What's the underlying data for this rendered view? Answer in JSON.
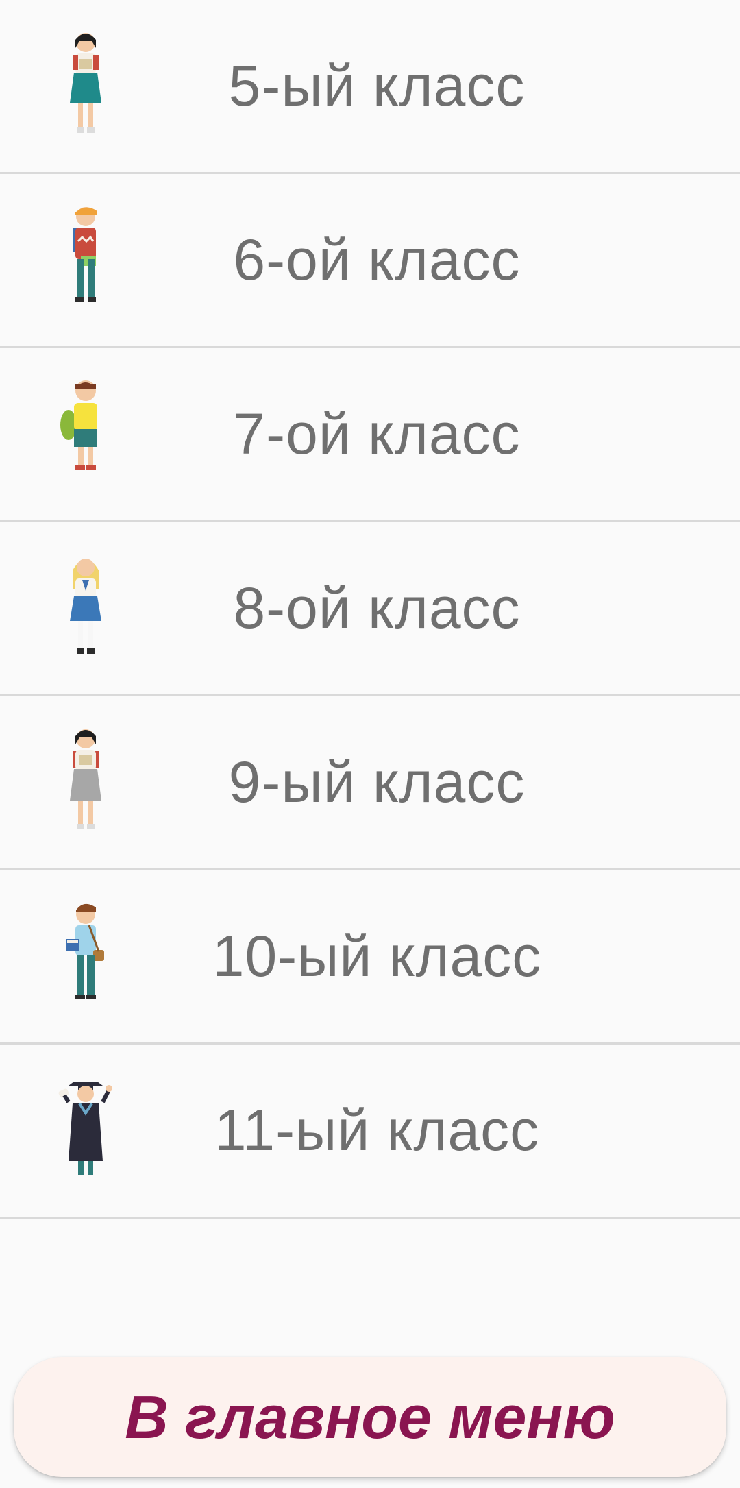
{
  "grades": [
    {
      "label": "5-ый класс",
      "icon": "student-girl-green-skirt-icon"
    },
    {
      "label": "6-ой класс",
      "icon": "student-boy-red-sweater-icon"
    },
    {
      "label": "7-ой класс",
      "icon": "student-boy-yellow-shirt-icon"
    },
    {
      "label": "8-ой класс",
      "icon": "student-girl-blonde-blue-skirt-icon"
    },
    {
      "label": "9-ый класс",
      "icon": "student-girl-grey-skirt-icon"
    },
    {
      "label": "10-ый класс",
      "icon": "student-boy-books-icon"
    },
    {
      "label": "11-ый класс",
      "icon": "graduate-icon"
    }
  ],
  "footer": {
    "main_menu_label": "В главное меню"
  },
  "colors": {
    "background": "#fafafa",
    "divider": "#d9d9d9",
    "label_text": "#6f6f6f",
    "button_bg": "#fdf2ee",
    "button_text": "#8a1550"
  }
}
